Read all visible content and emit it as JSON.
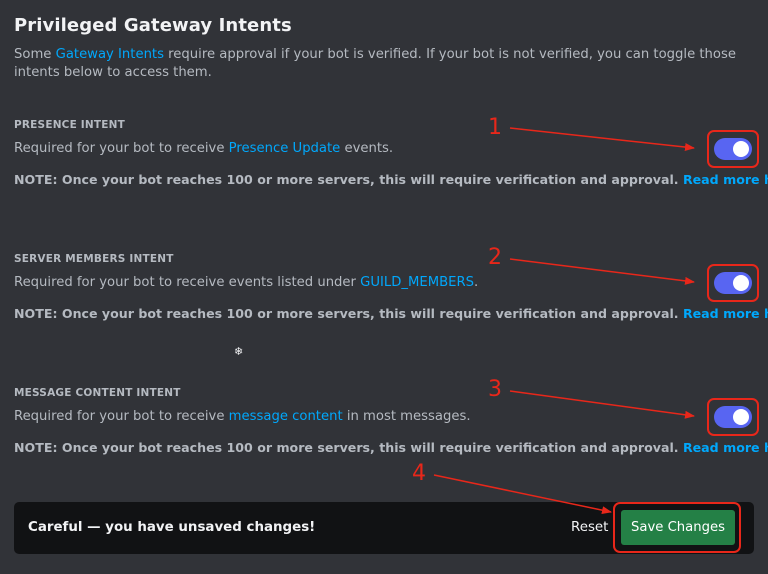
{
  "page": {
    "title": "Privileged Gateway Intents",
    "intro_prefix": "Some ",
    "intro_link": "Gateway Intents",
    "intro_suffix": " require approval if your bot is verified. If your bot is not verified, you can toggle those intents below to access them."
  },
  "intents": [
    {
      "heading": "PRESENCE INTENT",
      "desc_prefix": "Required for your bot to receive ",
      "desc_link": "Presence Update",
      "desc_suffix": " events.",
      "note": "NOTE: Once your bot reaches 100 or more servers, this will require verification and approval.",
      "note_link": "Read more here",
      "enabled": true,
      "annotation": "1"
    },
    {
      "heading": "SERVER MEMBERS INTENT",
      "desc_prefix": "Required for your bot to receive events listed under ",
      "desc_link": "GUILD_MEMBERS",
      "desc_suffix": ".",
      "note": "NOTE: Once your bot reaches 100 or more servers, this will require verification and approval.",
      "note_link": "Read more here",
      "enabled": true,
      "annotation": "2"
    },
    {
      "heading": "MESSAGE CONTENT INTENT",
      "desc_prefix": "Required for your bot to receive ",
      "desc_link": "message content",
      "desc_suffix": " in most messages.",
      "note": "NOTE: Once your bot reaches 100 or more servers, this will require verification and approval.",
      "note_link": "Read more here",
      "enabled": true,
      "annotation": "3"
    }
  ],
  "unsaved_bar": {
    "message": "Careful — you have unsaved changes!",
    "reset_label": "Reset",
    "save_label": "Save Changes",
    "annotation": "4"
  },
  "colors": {
    "background": "#313338",
    "link": "#00a8fc",
    "toggle_on": "#5865f2",
    "save_button": "#248046",
    "annotation": "#e8271a"
  },
  "icons": {
    "sparkle": "sparkle-icon"
  }
}
